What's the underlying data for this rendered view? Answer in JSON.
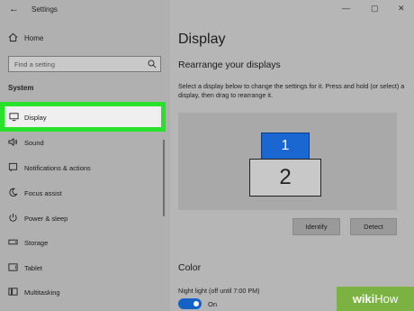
{
  "window": {
    "title": "Settings",
    "controls": [
      "—",
      "▢",
      "✕"
    ]
  },
  "sidebar": {
    "home_label": "Home",
    "search_placeholder": "Find a setting",
    "section_label": "System",
    "items": [
      {
        "label": "Display",
        "icon": "monitor-icon",
        "selected": true
      },
      {
        "label": "Sound",
        "icon": "speaker-icon"
      },
      {
        "label": "Notifications & actions",
        "icon": "notification-icon"
      },
      {
        "label": "Focus assist",
        "icon": "moon-icon"
      },
      {
        "label": "Power & sleep",
        "icon": "power-icon"
      },
      {
        "label": "Storage",
        "icon": "storage-icon"
      },
      {
        "label": "Tablet",
        "icon": "tablet-icon"
      },
      {
        "label": "Multitasking",
        "icon": "multitasking-icon"
      }
    ]
  },
  "main": {
    "title": "Display",
    "rearrange_title": "Rearrange your displays",
    "description": "Select a display below to change the settings for it. Press and hold (or select) a display, then drag to rearrange it.",
    "monitors": [
      "1",
      "2"
    ],
    "identify_label": "Identify",
    "detect_label": "Detect",
    "color_title": "Color",
    "night_light_label": "Night light (off until 7:00 PM)",
    "night_light_state": "On"
  },
  "watermark": {
    "bold": "wiki",
    "rest": "How"
  },
  "colors": {
    "highlight": "#27e12a",
    "accent": "#1562c6",
    "monitor_selected": "#1a67d2"
  }
}
